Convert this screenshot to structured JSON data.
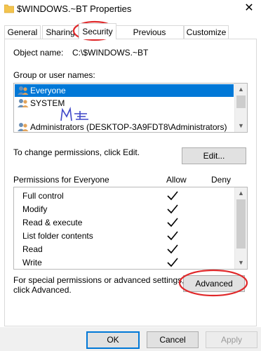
{
  "window": {
    "title": "$WINDOWS.~BT Properties",
    "close_label": "✕"
  },
  "tabs": [
    "General",
    "Sharing",
    "Security",
    "Previous Versions",
    "Customize"
  ],
  "security": {
    "object_name_label": "Object name:",
    "object_name_value": "C:\\$WINDOWS.~BT",
    "groups_label": "Group or user names:",
    "groups": [
      "Everyone",
      "SYSTEM",
      "Administrators (DESKTOP-3A9FDT8\\Administrators)"
    ],
    "change_text": "To change permissions, click Edit.",
    "edit_button": "Edit...",
    "permissions_label": "Permissions for Everyone",
    "allow_header": "Allow",
    "deny_header": "Deny",
    "permissions": [
      {
        "name": "Full control",
        "allow": true,
        "deny": false
      },
      {
        "name": "Modify",
        "allow": true,
        "deny": false
      },
      {
        "name": "Read & execute",
        "allow": true,
        "deny": false
      },
      {
        "name": "List folder contents",
        "allow": true,
        "deny": false
      },
      {
        "name": "Read",
        "allow": true,
        "deny": false
      },
      {
        "name": "Write",
        "allow": true,
        "deny": false
      }
    ],
    "advanced_text_line1": "For special permissions or advanced settings,",
    "advanced_text_line2": "click Advanced.",
    "advanced_button": "Advanced"
  },
  "footer": {
    "ok": "OK",
    "cancel": "Cancel",
    "apply": "Apply"
  },
  "colors": {
    "selection": "#0078d7",
    "annotation": "#e0282a"
  }
}
